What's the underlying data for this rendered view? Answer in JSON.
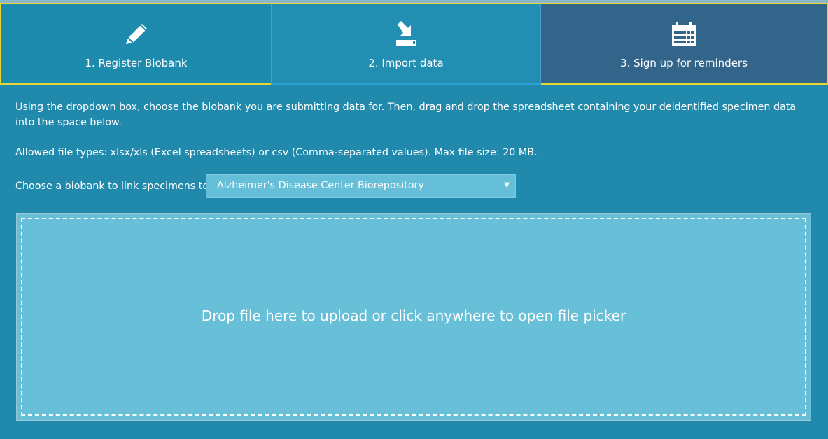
{
  "steps": [
    {
      "label": "1. Register Biobank",
      "icon": "pencil-icon"
    },
    {
      "label": "2. Import data",
      "icon": "import-icon"
    },
    {
      "label": "3. Sign up for reminders",
      "icon": "calendar-icon"
    }
  ],
  "instructions": {
    "text1": "Using the dropdown box, choose the biobank you are submitting data for. Then, drag and drop the spreadsheet containing your deidentified specimen data into the space below.",
    "text2": "Allowed file types: xlsx/xls (Excel spreadsheets) or csv (Comma-separated values). Max file size: 20 MB."
  },
  "biobank_select": {
    "label": "Choose a biobank to link specimens to:",
    "value": "Alzheimer's Disease Center Biorepository",
    "arrow": "▼"
  },
  "dropzone": {
    "text": "Drop file here to upload or click anywhere to open file picker"
  },
  "colors": {
    "background": "#218aac",
    "accent_border": "#e8d633",
    "active_step": "#228eb1",
    "reminder_step": "#336489",
    "dropzone": "#67c0d8"
  }
}
